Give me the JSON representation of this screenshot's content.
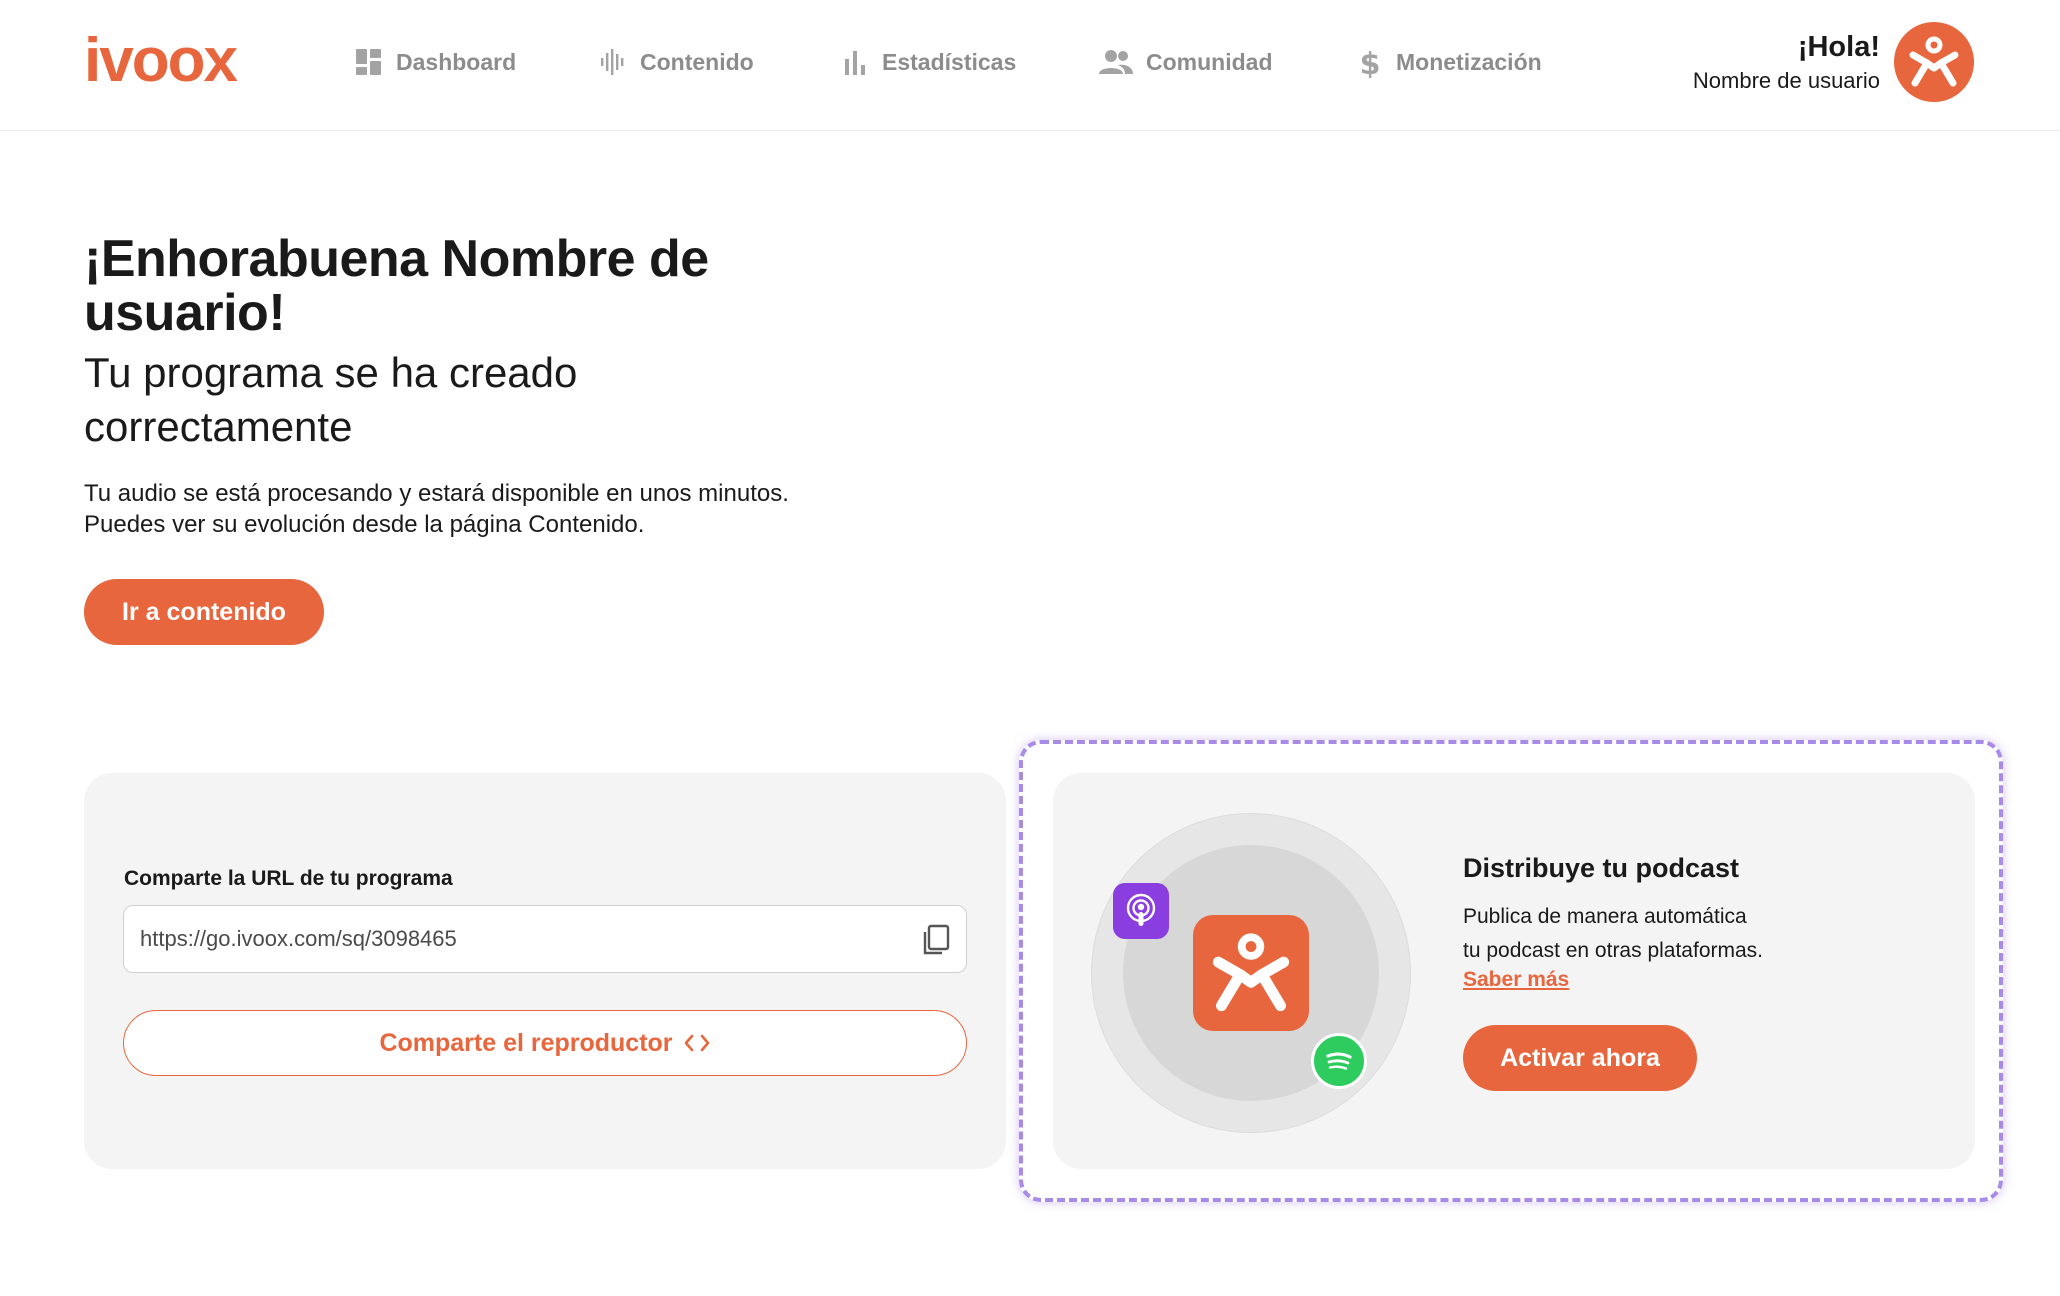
{
  "brand": {
    "logo_text": "ivoox",
    "accent_color": "#e8663d"
  },
  "nav": {
    "items": [
      {
        "label": "Dashboard",
        "icon": "dashboard-icon"
      },
      {
        "label": "Contenido",
        "icon": "audio-wave-icon"
      },
      {
        "label": "Estadísticas",
        "icon": "bar-chart-icon"
      },
      {
        "label": "Comunidad",
        "icon": "people-icon"
      },
      {
        "label": "Monetización",
        "icon": "dollar-icon"
      }
    ]
  },
  "user": {
    "greeting": "¡Hola!",
    "name": "Nombre de usuario",
    "avatar_icon": "ivoox-figure-icon"
  },
  "hero": {
    "title": "¡Enhorabuena Nombre de usuario!",
    "subtitle": "Tu programa se ha creado correctamente",
    "text_line1": "Tu audio se está procesando y estará disponible en unos minutos.",
    "text_line2": "Puedes ver su evolución desde la página Contenido.",
    "button_label": "Ir a contenido"
  },
  "share": {
    "label": "Comparte la URL de tu programa",
    "url_value": "https://go.ivoox.com/sq/3098465",
    "copy_icon": "copy-icon",
    "player_button_label": "Comparte el reproductor",
    "player_button_icon": "code-icon"
  },
  "distribute": {
    "title": "Distribuye tu podcast",
    "text_line1": "Publica de manera automática",
    "text_line2": "tu podcast en otras plataformas.",
    "link_label": "Saber más",
    "button_label": "Activar ahora",
    "platform_icons": [
      "ivoox-app-icon",
      "apple-podcasts-icon",
      "spotify-icon"
    ],
    "highlight_color": "#a88ae8"
  }
}
